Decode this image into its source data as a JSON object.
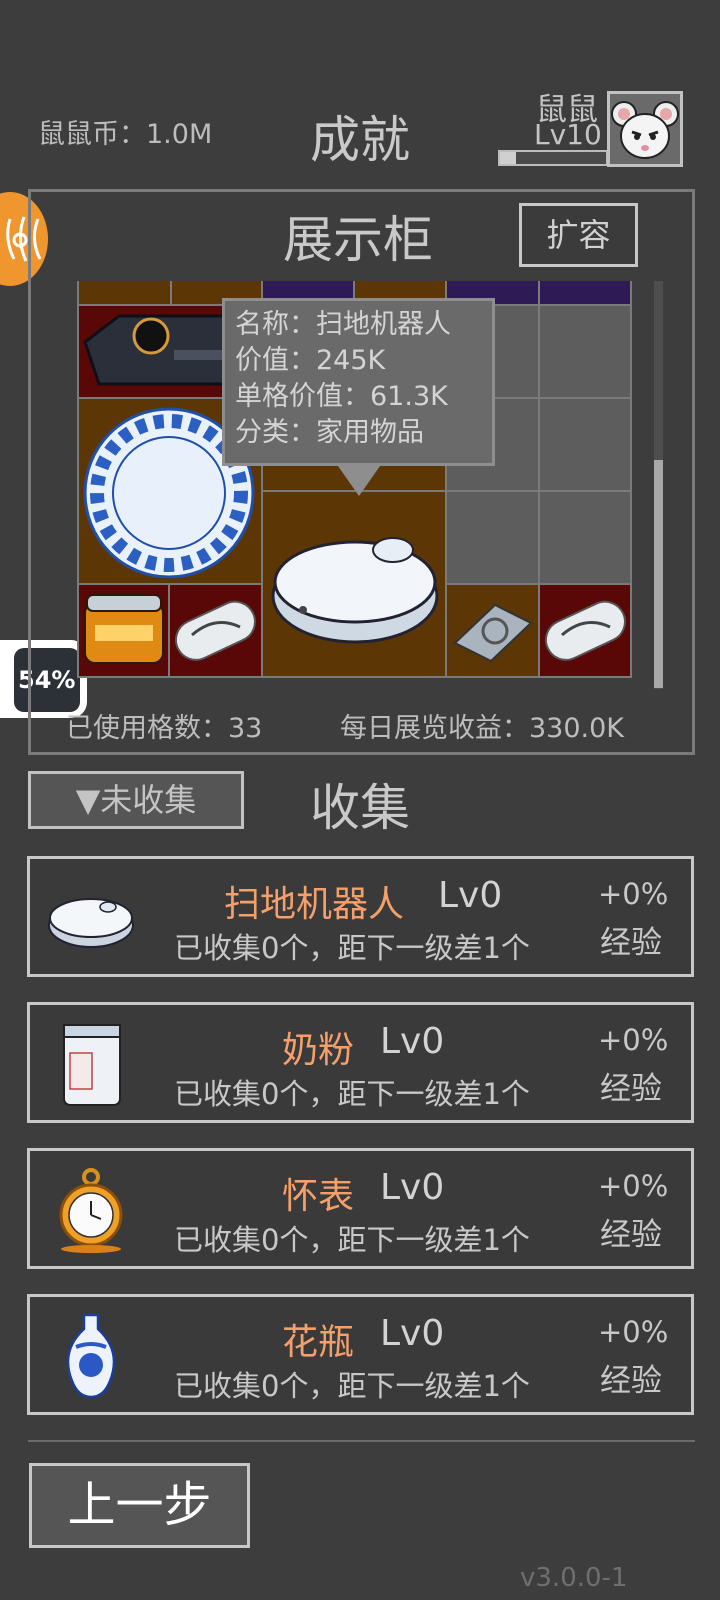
{
  "header": {
    "coins_label": "鼠鼠币：1.0M",
    "title": "成就",
    "player_name": "鼠鼠",
    "player_level": "Lv10",
    "xp_fraction": 0.15
  },
  "side": {
    "event_icon": "event-emblem-icon",
    "progress_text": "54%"
  },
  "cabinet": {
    "title": "展示柜",
    "expand_label": "扩容",
    "tooltip": {
      "name": "名称：扫地机器人",
      "value": "价值：245K",
      "cell_value": "单格价值：61.3K",
      "category": "分类：家用物品"
    },
    "used_cells": "已使用格数：33",
    "daily_income": "每日展览收益：330.0K"
  },
  "collect": {
    "filter_label": "▼未收集",
    "title": "收集",
    "items": [
      {
        "name": "扫地机器人",
        "level": "Lv0",
        "desc": "已收集0个，距下一级差1个",
        "exp": "+0%",
        "exp_label": "经验",
        "icon": "robot-vacuum-icon"
      },
      {
        "name": "奶粉",
        "level": "Lv0",
        "desc": "已收集0个，距下一级差1个",
        "exp": "+0%",
        "exp_label": "经验",
        "icon": "milk-powder-icon"
      },
      {
        "name": "怀表",
        "level": "Lv0",
        "desc": "已收集0个，距下一级差1个",
        "exp": "+0%",
        "exp_label": "经验",
        "icon": "pocket-watch-icon"
      },
      {
        "name": "花瓶",
        "level": "Lv0",
        "desc": "已收集0个，距下一级差1个",
        "exp": "+0%",
        "exp_label": "经验",
        "icon": "vase-icon"
      }
    ]
  },
  "footer": {
    "back_label": "上一步",
    "version": "v3.0.0-1"
  }
}
